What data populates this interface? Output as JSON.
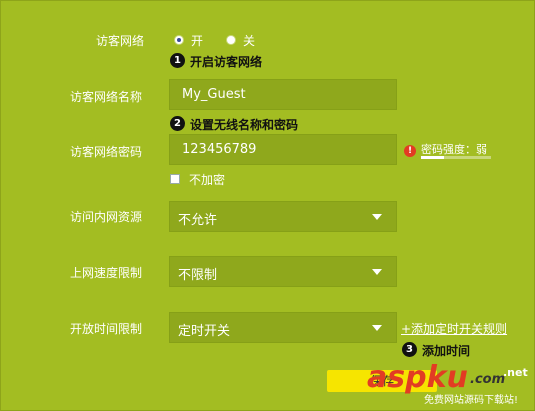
{
  "guest_network": {
    "label": "访客网络",
    "option_on": "开",
    "option_off": "关",
    "selected": "开",
    "hint_number": "1",
    "hint": "开启访客网络"
  },
  "ssid": {
    "label": "访客网络名称",
    "value": "My_Guest",
    "hint_number": "2",
    "hint": "设置无线名称和密码"
  },
  "password": {
    "label": "访客网络密码",
    "value": "123456789",
    "strength_label": "密码强度：弱",
    "strength_fraction": 0.33,
    "no_encrypt_label": "不加密",
    "no_encrypt_checked": false
  },
  "lan_access": {
    "label": "访问内网资源",
    "value": "不允许"
  },
  "speed_limit": {
    "label": "上网速度限制",
    "value": "不限制"
  },
  "open_time": {
    "label": "开放时间限制",
    "value": "定时开关",
    "add_rule_link": "+添加定时开关规则",
    "hint_number": "3",
    "hint": "添加时间"
  },
  "save_button": "保存",
  "watermark": {
    "brand": "aspku",
    "suffix": ".com",
    "net": ".net",
    "tagline": "免费网站源码下载站!"
  },
  "colors": {
    "background": "#a3bd22",
    "field": "#8fa81c",
    "save": "#f6e500",
    "warning": "#e23c23"
  }
}
